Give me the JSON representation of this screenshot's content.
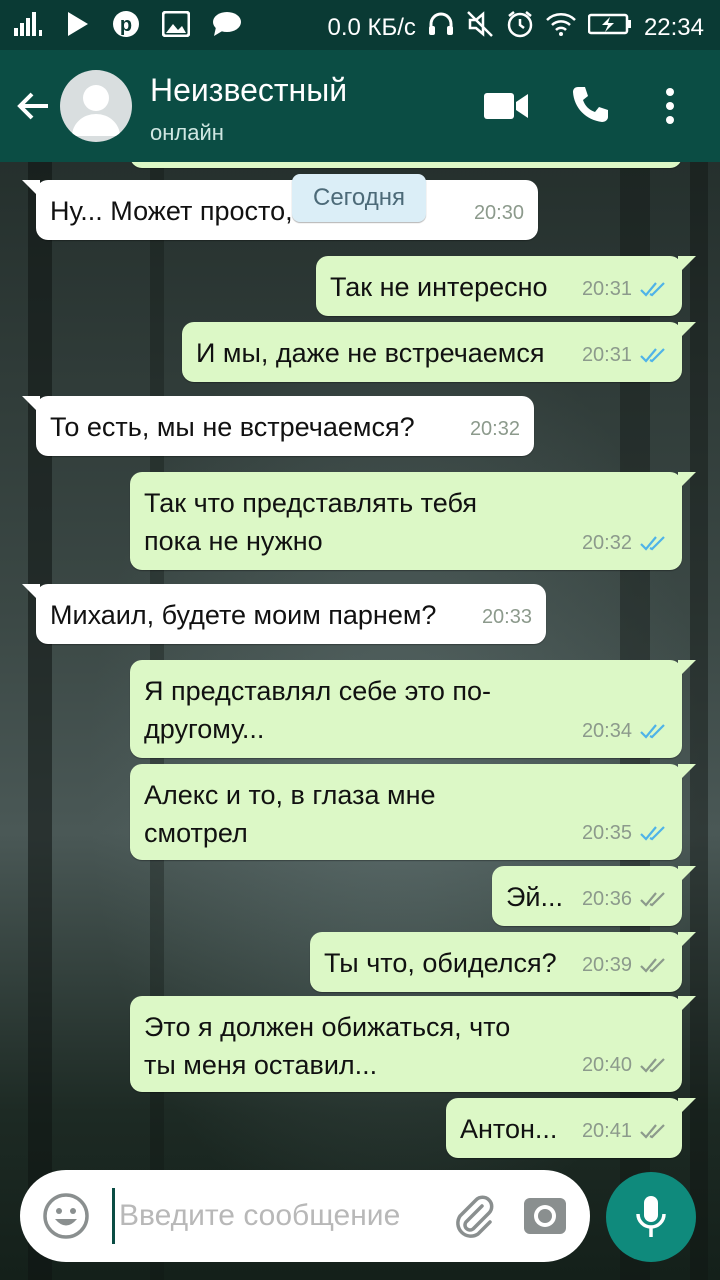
{
  "status_bar": {
    "net_speed": "0.0 КБ/с",
    "time": "22:34"
  },
  "header": {
    "contact_name": "Неизвестный",
    "status": "онлайн"
  },
  "date_chip": "Сегодня",
  "messages": [
    {
      "direction": "in",
      "text": "Ну... Может просто, котенкий",
      "time": "20:30"
    },
    {
      "direction": "out",
      "text": "Так не интересно",
      "time": "20:31",
      "read": true
    },
    {
      "direction": "out",
      "text": "И мы, даже не встречаемся",
      "time": "20:31",
      "read": true
    },
    {
      "direction": "in",
      "text": "То есть, мы не встречаемся?",
      "time": "20:32"
    },
    {
      "direction": "out",
      "text": "Так что представлять тебя\nпока не нужно",
      "time": "20:32",
      "read": true
    },
    {
      "direction": "in",
      "text": "Михаил, будете моим парнем?",
      "time": "20:33"
    },
    {
      "direction": "out",
      "text": "Я представлял себе это по-\nдругому...",
      "time": "20:34",
      "read": true
    },
    {
      "direction": "out",
      "text": "Алекс и то, в глаза мне\nсмотрел",
      "time": "20:35",
      "read": true
    },
    {
      "direction": "out",
      "text": "Эй...",
      "time": "20:36",
      "read": false
    },
    {
      "direction": "out",
      "text": "Ты что, обиделся?",
      "time": "20:39",
      "read": false
    },
    {
      "direction": "out",
      "text": "Это я должен обижаться, что\nты меня оставил...",
      "time": "20:40",
      "read": false
    },
    {
      "direction": "out",
      "text": "Антон...",
      "time": "20:41",
      "read": false
    }
  ],
  "input": {
    "placeholder": "Введите сообщение"
  },
  "colors": {
    "header": "#0b4d44",
    "outgoing_bubble": "#dcf8c6",
    "incoming_bubble": "#ffffff",
    "read_ticks": "#4fb3e8",
    "delivered_ticks": "#8c9a8c",
    "mic_button": "#0f8a7c"
  }
}
